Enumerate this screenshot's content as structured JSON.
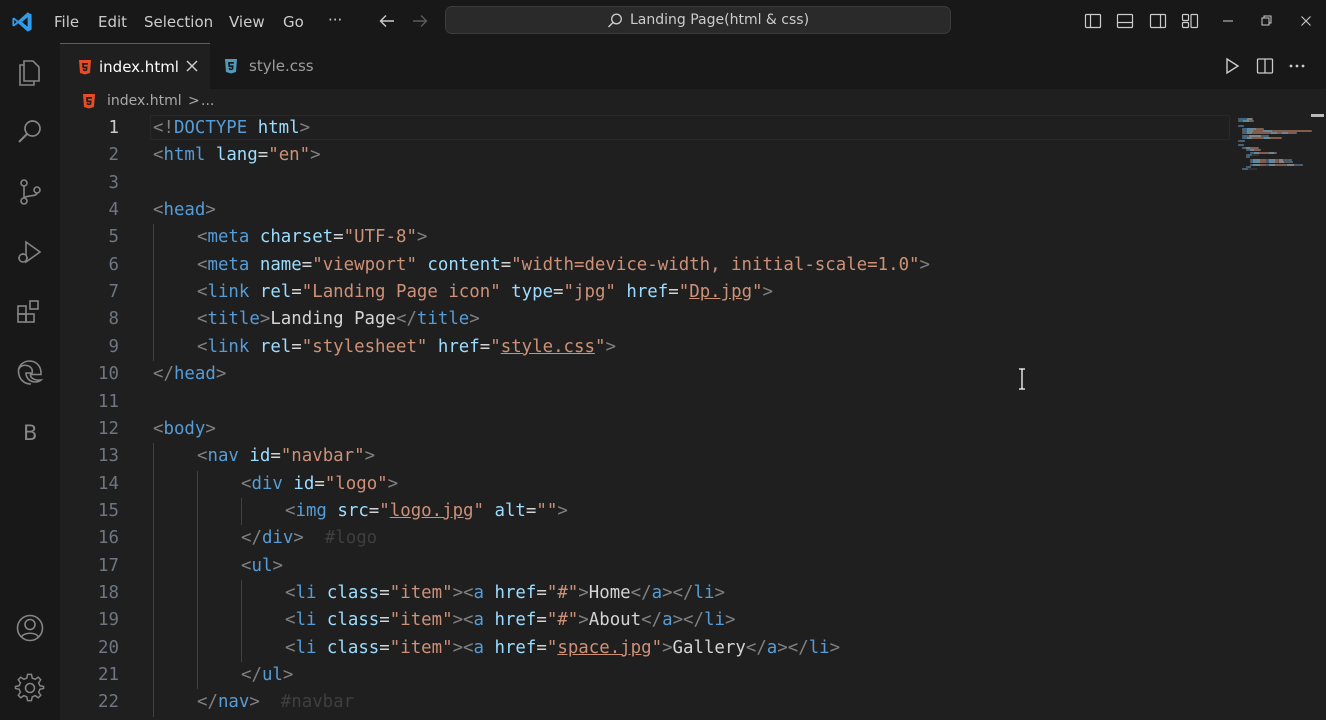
{
  "menu": {
    "file": "File",
    "edit": "Edit",
    "selection": "Selection",
    "view": "View",
    "go": "Go",
    "more": "···"
  },
  "command_center": {
    "label": "Landing Page(html & css)"
  },
  "tabs": [
    {
      "label": "index.html",
      "active": true,
      "icon": "html5-icon"
    },
    {
      "label": "style.css",
      "active": false,
      "icon": "css3-icon"
    }
  ],
  "breadcrumb": {
    "file": "index.html",
    "separator": ">",
    "more": "..."
  },
  "editor": {
    "active_line": 1,
    "lines": [
      {
        "n": "1",
        "ind": 0,
        "t": [
          [
            "tg",
            "<!"
          ],
          [
            "tn",
            "DOCTYPE"
          ],
          [
            "an",
            " html"
          ],
          [
            "tg",
            ">"
          ]
        ]
      },
      {
        "n": "2",
        "ind": 0,
        "t": [
          [
            "tg",
            "<"
          ],
          [
            "tn",
            "html"
          ],
          [
            "an",
            " lang"
          ],
          [
            "tx",
            "="
          ],
          [
            "av",
            "\"en\""
          ],
          [
            "tg",
            ">"
          ]
        ]
      },
      {
        "n": "3",
        "ind": 0,
        "t": []
      },
      {
        "n": "4",
        "ind": 0,
        "t": [
          [
            "tg",
            "<"
          ],
          [
            "tn",
            "head"
          ],
          [
            "tg",
            ">"
          ]
        ]
      },
      {
        "n": "5",
        "ind": 1,
        "t": [
          [
            "tg",
            "<"
          ],
          [
            "tn",
            "meta"
          ],
          [
            "an",
            " charset"
          ],
          [
            "tx",
            "="
          ],
          [
            "av",
            "\"UTF-8\""
          ],
          [
            "tg",
            ">"
          ]
        ]
      },
      {
        "n": "6",
        "ind": 1,
        "t": [
          [
            "tg",
            "<"
          ],
          [
            "tn",
            "meta"
          ],
          [
            "an",
            " name"
          ],
          [
            "tx",
            "="
          ],
          [
            "av",
            "\"viewport\""
          ],
          [
            "an",
            " content"
          ],
          [
            "tx",
            "="
          ],
          [
            "av",
            "\"width=device-width, initial-scale=1.0\""
          ],
          [
            "tg",
            ">"
          ]
        ]
      },
      {
        "n": "7",
        "ind": 1,
        "t": [
          [
            "tg",
            "<"
          ],
          [
            "tn",
            "link"
          ],
          [
            "an",
            " rel"
          ],
          [
            "tx",
            "="
          ],
          [
            "av",
            "\"Landing Page icon\""
          ],
          [
            "an",
            " type"
          ],
          [
            "tx",
            "="
          ],
          [
            "av",
            "\"jpg\""
          ],
          [
            "an",
            " href"
          ],
          [
            "tx",
            "="
          ],
          [
            "av",
            "\""
          ],
          [
            "avl",
            "Dp.jpg"
          ],
          [
            "av",
            "\""
          ],
          [
            "tg",
            ">"
          ]
        ]
      },
      {
        "n": "8",
        "ind": 1,
        "t": [
          [
            "tg",
            "<"
          ],
          [
            "tn",
            "title"
          ],
          [
            "tg",
            ">"
          ],
          [
            "tx",
            "Landing Page"
          ],
          [
            "tg",
            "</"
          ],
          [
            "tn",
            "title"
          ],
          [
            "tg",
            ">"
          ]
        ]
      },
      {
        "n": "9",
        "ind": 1,
        "t": [
          [
            "tg",
            "<"
          ],
          [
            "tn",
            "link"
          ],
          [
            "an",
            " rel"
          ],
          [
            "tx",
            "="
          ],
          [
            "av",
            "\"stylesheet\""
          ],
          [
            "an",
            " href"
          ],
          [
            "tx",
            "="
          ],
          [
            "av",
            "\""
          ],
          [
            "avl",
            "style.css"
          ],
          [
            "av",
            "\""
          ],
          [
            "tg",
            ">"
          ]
        ]
      },
      {
        "n": "10",
        "ind": 0,
        "t": [
          [
            "tg",
            "</"
          ],
          [
            "tn",
            "head"
          ],
          [
            "tg",
            ">"
          ]
        ]
      },
      {
        "n": "11",
        "ind": 0,
        "t": []
      },
      {
        "n": "12",
        "ind": 0,
        "t": [
          [
            "tg",
            "<"
          ],
          [
            "tn",
            "body"
          ],
          [
            "tg",
            ">"
          ]
        ]
      },
      {
        "n": "13",
        "ind": 1,
        "t": [
          [
            "tg",
            "<"
          ],
          [
            "tn",
            "nav"
          ],
          [
            "an",
            " id"
          ],
          [
            "tx",
            "="
          ],
          [
            "av",
            "\"navbar\""
          ],
          [
            "tg",
            ">"
          ]
        ]
      },
      {
        "n": "14",
        "ind": 2,
        "t": [
          [
            "tg",
            "<"
          ],
          [
            "tn",
            "div"
          ],
          [
            "an",
            " id"
          ],
          [
            "tx",
            "="
          ],
          [
            "av",
            "\"logo\""
          ],
          [
            "tg",
            ">"
          ]
        ]
      },
      {
        "n": "15",
        "ind": 3,
        "t": [
          [
            "tg",
            "<"
          ],
          [
            "tn",
            "img"
          ],
          [
            "an",
            " src"
          ],
          [
            "tx",
            "="
          ],
          [
            "av",
            "\""
          ],
          [
            "avl",
            "logo.jpg"
          ],
          [
            "av",
            "\""
          ],
          [
            "an",
            " alt"
          ],
          [
            "tx",
            "="
          ],
          [
            "av",
            "\"\""
          ],
          [
            "tg",
            ">"
          ]
        ]
      },
      {
        "n": "16",
        "ind": 2,
        "t": [
          [
            "tg",
            "</"
          ],
          [
            "tn",
            "div"
          ],
          [
            "tg",
            ">"
          ],
          [
            "hint",
            "  #logo"
          ]
        ]
      },
      {
        "n": "17",
        "ind": 2,
        "t": [
          [
            "tg",
            "<"
          ],
          [
            "tn",
            "ul"
          ],
          [
            "tg",
            ">"
          ]
        ]
      },
      {
        "n": "18",
        "ind": 3,
        "t": [
          [
            "tg",
            "<"
          ],
          [
            "tn",
            "li"
          ],
          [
            "an",
            " class"
          ],
          [
            "tx",
            "="
          ],
          [
            "av",
            "\"item\""
          ],
          [
            "tg",
            "><"
          ],
          [
            "tn",
            "a"
          ],
          [
            "an",
            " href"
          ],
          [
            "tx",
            "="
          ],
          [
            "av",
            "\"#\""
          ],
          [
            "tg",
            ">"
          ],
          [
            "tx",
            "Home"
          ],
          [
            "tg",
            "</"
          ],
          [
            "tn",
            "a"
          ],
          [
            "tg",
            "></"
          ],
          [
            "tn",
            "li"
          ],
          [
            "tg",
            ">"
          ]
        ]
      },
      {
        "n": "19",
        "ind": 3,
        "t": [
          [
            "tg",
            "<"
          ],
          [
            "tn",
            "li"
          ],
          [
            "an",
            " class"
          ],
          [
            "tx",
            "="
          ],
          [
            "av",
            "\"item\""
          ],
          [
            "tg",
            "><"
          ],
          [
            "tn",
            "a"
          ],
          [
            "an",
            " href"
          ],
          [
            "tx",
            "="
          ],
          [
            "av",
            "\"#\""
          ],
          [
            "tg",
            ">"
          ],
          [
            "tx",
            "About"
          ],
          [
            "tg",
            "</"
          ],
          [
            "tn",
            "a"
          ],
          [
            "tg",
            "></"
          ],
          [
            "tn",
            "li"
          ],
          [
            "tg",
            ">"
          ]
        ]
      },
      {
        "n": "20",
        "ind": 3,
        "t": [
          [
            "tg",
            "<"
          ],
          [
            "tn",
            "li"
          ],
          [
            "an",
            " class"
          ],
          [
            "tx",
            "="
          ],
          [
            "av",
            "\"item\""
          ],
          [
            "tg",
            "><"
          ],
          [
            "tn",
            "a"
          ],
          [
            "an",
            " href"
          ],
          [
            "tx",
            "="
          ],
          [
            "av",
            "\""
          ],
          [
            "avl",
            "space.jpg"
          ],
          [
            "av",
            "\""
          ],
          [
            "tg",
            ">"
          ],
          [
            "tx",
            "Gallery"
          ],
          [
            "tg",
            "</"
          ],
          [
            "tn",
            "a"
          ],
          [
            "tg",
            "></"
          ],
          [
            "tn",
            "li"
          ],
          [
            "tg",
            ">"
          ]
        ]
      },
      {
        "n": "21",
        "ind": 2,
        "t": [
          [
            "tg",
            "</"
          ],
          [
            "tn",
            "ul"
          ],
          [
            "tg",
            ">"
          ]
        ]
      },
      {
        "n": "22",
        "ind": 1,
        "t": [
          [
            "tg",
            "</"
          ],
          [
            "tn",
            "nav"
          ],
          [
            "tg",
            ">"
          ],
          [
            "hint",
            "  #navbar"
          ]
        ]
      }
    ]
  },
  "colors": {
    "background": "#1f1f1f",
    "chrome": "#181818",
    "accent": "#0078d4",
    "tag_bracket": "#808080",
    "tag_name": "#569cd6",
    "attr_name": "#9cdcfe",
    "attr_value": "#ce9178",
    "text": "#d4d4d4"
  }
}
